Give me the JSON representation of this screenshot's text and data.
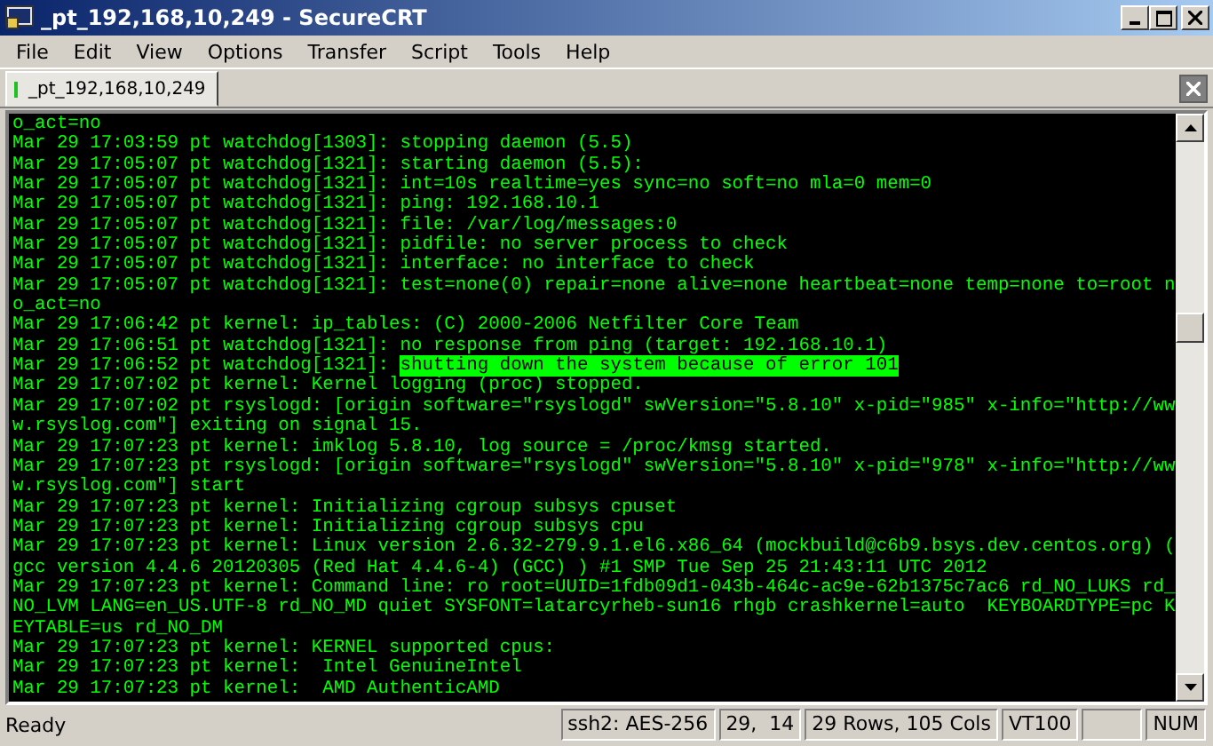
{
  "window": {
    "title": "_pt_192,168,10,249 - SecureCRT"
  },
  "menu": [
    "File",
    "Edit",
    "View",
    "Options",
    "Transfer",
    "Script",
    "Tools",
    "Help"
  ],
  "tabs": [
    {
      "label": "_pt_192,168,10,249",
      "selected": true,
      "connected": true
    }
  ],
  "terminal": {
    "lines": [
      [
        {
          "text": "o_act=no",
          "highlighted": false
        }
      ],
      [
        {
          "text": "Mar 29 17:03:59 pt watchdog[1303]: stopping daemon (5.5)",
          "highlighted": false
        }
      ],
      [
        {
          "text": "Mar 29 17:05:07 pt watchdog[1321]: starting daemon (5.5):",
          "highlighted": false
        }
      ],
      [
        {
          "text": "Mar 29 17:05:07 pt watchdog[1321]: int=10s realtime=yes sync=no soft=no mla=0 mem=0",
          "highlighted": false
        }
      ],
      [
        {
          "text": "Mar 29 17:05:07 pt watchdog[1321]: ping: 192.168.10.1",
          "highlighted": false
        }
      ],
      [
        {
          "text": "Mar 29 17:05:07 pt watchdog[1321]: file: /var/log/messages:0",
          "highlighted": false
        }
      ],
      [
        {
          "text": "Mar 29 17:05:07 pt watchdog[1321]: pidfile: no server process to check",
          "highlighted": false
        }
      ],
      [
        {
          "text": "Mar 29 17:05:07 pt watchdog[1321]: interface: no interface to check",
          "highlighted": false
        }
      ],
      [
        {
          "text": "Mar 29 17:05:07 pt watchdog[1321]: test=none(0) repair=none alive=none heartbeat=none temp=none to=root n",
          "highlighted": false
        }
      ],
      [
        {
          "text": "o_act=no",
          "highlighted": false
        }
      ],
      [
        {
          "text": "Mar 29 17:06:42 pt kernel: ip_tables: (C) 2000-2006 Netfilter Core Team",
          "highlighted": false
        }
      ],
      [
        {
          "text": "Mar 29 17:06:51 pt watchdog[1321]: no response from ping (target: 192.168.10.1)",
          "highlighted": false
        }
      ],
      [
        {
          "text": "Mar 29 17:06:52 pt watchdog[1321]: ",
          "highlighted": false
        },
        {
          "text": "shutting down the system because of error 101",
          "highlighted": true
        }
      ],
      [
        {
          "text": "Mar 29 17:07:02 pt kernel: Kernel logging (proc) stopped.",
          "highlighted": false
        }
      ],
      [
        {
          "text": "Mar 29 17:07:02 pt rsyslogd: [origin software=\"rsyslogd\" swVersion=\"5.8.10\" x-pid=\"985\" x-info=\"http://ww",
          "highlighted": false
        }
      ],
      [
        {
          "text": "w.rsyslog.com\"] exiting on signal 15.",
          "highlighted": false
        }
      ],
      [
        {
          "text": "Mar 29 17:07:23 pt kernel: imklog 5.8.10, log source = /proc/kmsg started.",
          "highlighted": false
        }
      ],
      [
        {
          "text": "Mar 29 17:07:23 pt rsyslogd: [origin software=\"rsyslogd\" swVersion=\"5.8.10\" x-pid=\"978\" x-info=\"http://ww",
          "highlighted": false
        }
      ],
      [
        {
          "text": "w.rsyslog.com\"] start",
          "highlighted": false
        }
      ],
      [
        {
          "text": "Mar 29 17:07:23 pt kernel: Initializing cgroup subsys cpuset",
          "highlighted": false
        }
      ],
      [
        {
          "text": "Mar 29 17:07:23 pt kernel: Initializing cgroup subsys cpu",
          "highlighted": false
        }
      ],
      [
        {
          "text": "Mar 29 17:07:23 pt kernel: Linux version 2.6.32-279.9.1.el6.x86_64 (mockbuild@c6b9.bsys.dev.centos.org) (",
          "highlighted": false
        }
      ],
      [
        {
          "text": "gcc version 4.4.6 20120305 (Red Hat 4.4.6-4) (GCC) ) #1 SMP Tue Sep 25 21:43:11 UTC 2012",
          "highlighted": false
        }
      ],
      [
        {
          "text": "Mar 29 17:07:23 pt kernel: Command line: ro root=UUID=1fdb09d1-043b-464c-ac9e-62b1375c7ac6 rd_NO_LUKS rd_",
          "highlighted": false
        }
      ],
      [
        {
          "text": "NO_LVM LANG=en_US.UTF-8 rd_NO_MD quiet SYSFONT=latarcyrheb-sun16 rhgb crashkernel=auto  KEYBOARDTYPE=pc K",
          "highlighted": false
        }
      ],
      [
        {
          "text": "EYTABLE=us rd_NO_DM",
          "highlighted": false
        }
      ],
      [
        {
          "text": "Mar 29 17:07:23 pt kernel: KERNEL supported cpus:",
          "highlighted": false
        }
      ],
      [
        {
          "text": "Mar 29 17:07:23 pt kernel:  Intel GenuineIntel",
          "highlighted": false
        }
      ],
      [
        {
          "text": "Mar 29 17:07:23 pt kernel:  AMD AuthenticAMD",
          "highlighted": false
        }
      ]
    ]
  },
  "status_bar": [
    "Ready",
    "ssh2: AES-256",
    "29,  14",
    "29 Rows, 105 Cols",
    "VT100",
    "NUM"
  ]
}
